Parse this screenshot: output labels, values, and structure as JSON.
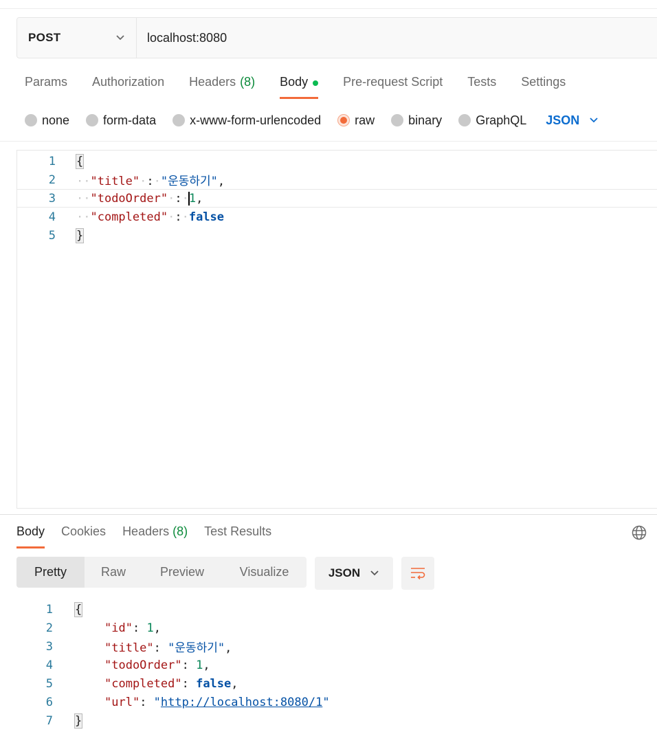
{
  "request": {
    "method": "POST",
    "url": "localhost:8080"
  },
  "request_tabs": [
    {
      "label": "Params",
      "count": ""
    },
    {
      "label": "Authorization",
      "count": ""
    },
    {
      "label": "Headers",
      "count": "(8)"
    },
    {
      "label": "Body",
      "count": ""
    },
    {
      "label": "Pre-request Script",
      "count": ""
    },
    {
      "label": "Tests",
      "count": ""
    },
    {
      "label": "Settings",
      "count": ""
    }
  ],
  "body_types": {
    "options": [
      "none",
      "form-data",
      "x-www-form-urlencoded",
      "raw",
      "binary",
      "GraphQL"
    ],
    "selected": "raw",
    "format": "JSON"
  },
  "request_body": {
    "line_numbers": [
      "1",
      "2",
      "3",
      "4",
      "5"
    ],
    "open_brace": "{",
    "close_brace": "}",
    "k1": "\"title\"",
    "v1": "\"운동하기\"",
    "k2": "\"todoOrder\"",
    "v2": "1",
    "k3": "\"completed\"",
    "v3": "false"
  },
  "response_tabs": [
    {
      "label": "Body",
      "count": ""
    },
    {
      "label": "Cookies",
      "count": ""
    },
    {
      "label": "Headers",
      "count": "(8)"
    },
    {
      "label": "Test Results",
      "count": ""
    }
  ],
  "response_view": {
    "modes": [
      "Pretty",
      "Raw",
      "Preview",
      "Visualize"
    ],
    "active": "Pretty",
    "format": "JSON"
  },
  "response_body": {
    "line_numbers": [
      "1",
      "2",
      "3",
      "4",
      "5",
      "6",
      "7"
    ],
    "open_brace": "{",
    "close_brace": "}",
    "k1": "\"id\"",
    "v1": "1",
    "k2": "\"title\"",
    "v2": "\"운동하기\"",
    "k3": "\"todoOrder\"",
    "v3": "1",
    "k4": "\"completed\"",
    "v4": "false",
    "k5": "\"url\"",
    "v5_open": "\"",
    "v5_link": "http://localhost:8080/1",
    "v5_close": "\""
  },
  "colors": {
    "accent": "#f26b3a",
    "json_link": "#0b6ccf",
    "count_green": "#0b8a3a"
  }
}
